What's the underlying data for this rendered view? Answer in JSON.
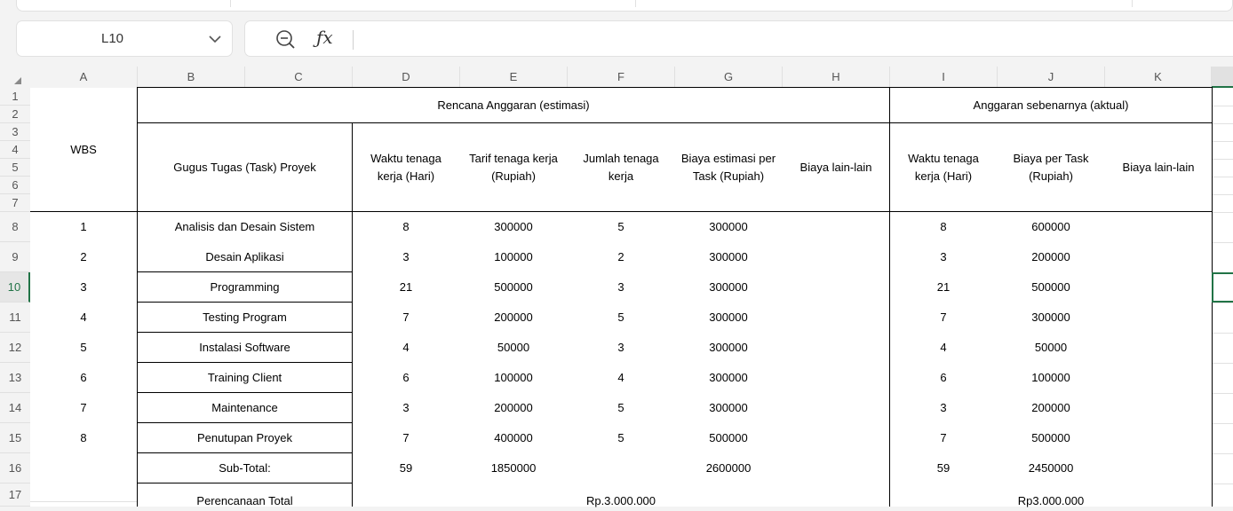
{
  "name_box": {
    "value": "L10"
  },
  "formula_bar": {
    "value": ""
  },
  "columns": [
    "A",
    "B",
    "C",
    "D",
    "E",
    "F",
    "G",
    "H",
    "I",
    "J",
    "K"
  ],
  "rows": [
    "1",
    "2",
    "3",
    "4",
    "5",
    "6",
    "7",
    "8",
    "9",
    "10",
    "11",
    "12",
    "13",
    "14",
    "15",
    "16",
    "17"
  ],
  "headers": {
    "wbs": "WBS",
    "plan_group": "Rencana Anggaran (estimasi)",
    "actual_group": "Anggaran sebenarnya (aktual)",
    "task": "Gugus Tugas (Task) Proyek",
    "plan_time": "Waktu tenaga kerja (Hari)",
    "plan_rate": "Tarif tenaga kerja (Rupiah)",
    "plan_count": "Jumlah tenaga kerja",
    "plan_cost": "Biaya estimasi per Task (Rupiah)",
    "plan_other": "Biaya lain-lain",
    "act_time": "Waktu tenaga kerja (Hari)",
    "act_cost": "Biaya per Task (Rupiah)",
    "act_other": "Biaya lain-lain"
  },
  "tasks": [
    {
      "wbs": "1",
      "name": "Analisis dan Desain Sistem",
      "d": "8",
      "e": "300000",
      "f": "5",
      "g": "300000",
      "i": "8",
      "j": "600000"
    },
    {
      "wbs": "2",
      "name": "Desain Aplikasi",
      "d": "3",
      "e": "100000",
      "f": "2",
      "g": "300000",
      "i": "3",
      "j": "200000"
    },
    {
      "wbs": "3",
      "name": "Programming",
      "d": "21",
      "e": "500000",
      "f": "3",
      "g": "300000",
      "i": "21",
      "j": "500000"
    },
    {
      "wbs": "4",
      "name": "Testing Program",
      "d": "7",
      "e": "200000",
      "f": "5",
      "g": "300000",
      "i": "7",
      "j": "300000"
    },
    {
      "wbs": "5",
      "name": "Instalasi Software",
      "d": "4",
      "e": "50000",
      "f": "3",
      "g": "300000",
      "i": "4",
      "j": "50000"
    },
    {
      "wbs": "6",
      "name": "Training Client",
      "d": "6",
      "e": "100000",
      "f": "4",
      "g": "300000",
      "i": "6",
      "j": "100000"
    },
    {
      "wbs": "7",
      "name": "Maintenance",
      "d": "3",
      "e": "200000",
      "f": "5",
      "g": "300000",
      "i": "3",
      "j": "200000"
    },
    {
      "wbs": "8",
      "name": "Penutupan Proyek",
      "d": "7",
      "e": "400000",
      "f": "5",
      "g": "500000",
      "i": "7",
      "j": "500000"
    }
  ],
  "subtotal": {
    "label": "Sub-Total:",
    "d": "59",
    "e": "1850000",
    "g": "2600000",
    "i": "59",
    "j": "2450000"
  },
  "total": {
    "label": "Perencanaan Total",
    "plan": "Rp.3.000.000",
    "actual": "Rp3.000.000"
  },
  "selected_cell": "L10",
  "accent_color": "#217346"
}
